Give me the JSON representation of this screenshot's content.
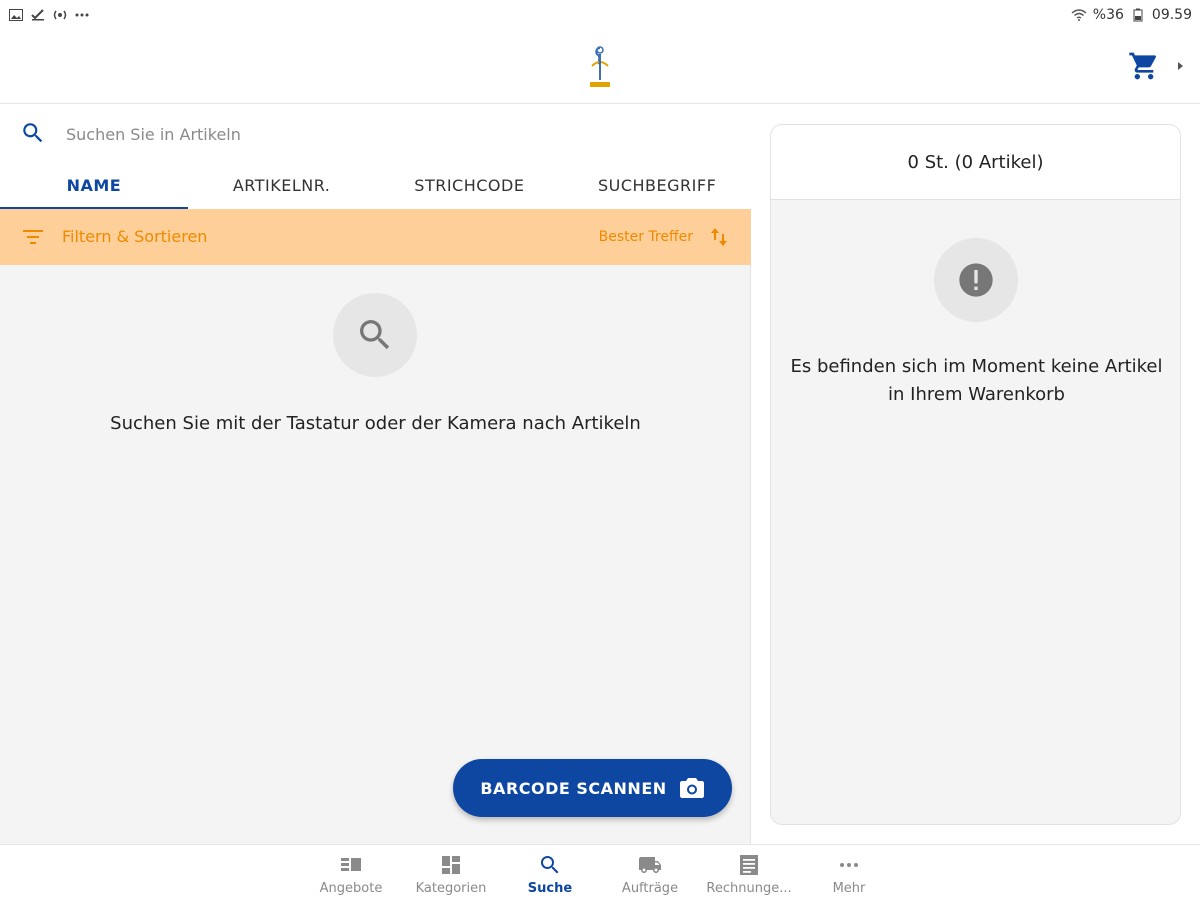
{
  "status_bar": {
    "battery": "%36",
    "time": "09.59"
  },
  "app_bar": {
    "logo": "company-logo",
    "cart_icon": "cart-icon"
  },
  "search": {
    "placeholder": "Suchen Sie in Artikeln",
    "tabs": [
      "NAME",
      "ARTIKELNR.",
      "STRICHCODE",
      "SUCHBEGRIFF"
    ],
    "active_tab": "NAME",
    "filter_label": "Filtern & Sortieren",
    "sort_label": "Bester Treffer",
    "empty_message": "Suchen Sie mit der Tastatur oder der Kamera nach Artikeln",
    "scan_button": "BARCODE SCANNEN"
  },
  "cart": {
    "summary": "0 St. (0 Artikel)",
    "empty_message_line1": "Es befinden sich im Moment keine Artikel",
    "empty_message_line2": "in Ihrem Warenkorb"
  },
  "bottom_nav": {
    "items": [
      {
        "label": "Angebote",
        "icon": "offers-icon"
      },
      {
        "label": "Kategorien",
        "icon": "categories-icon"
      },
      {
        "label": "Suche",
        "icon": "search-icon"
      },
      {
        "label": "Aufträge",
        "icon": "truck-icon"
      },
      {
        "label": "Rechnunge...",
        "icon": "invoice-icon"
      },
      {
        "label": "Mehr",
        "icon": "more-icon"
      }
    ],
    "active": "Suche"
  },
  "colors": {
    "primary": "#0d47a1",
    "filter_bg": "#ffcf99",
    "filter_text": "#ef8a00",
    "muted": "#8a8a8a"
  }
}
